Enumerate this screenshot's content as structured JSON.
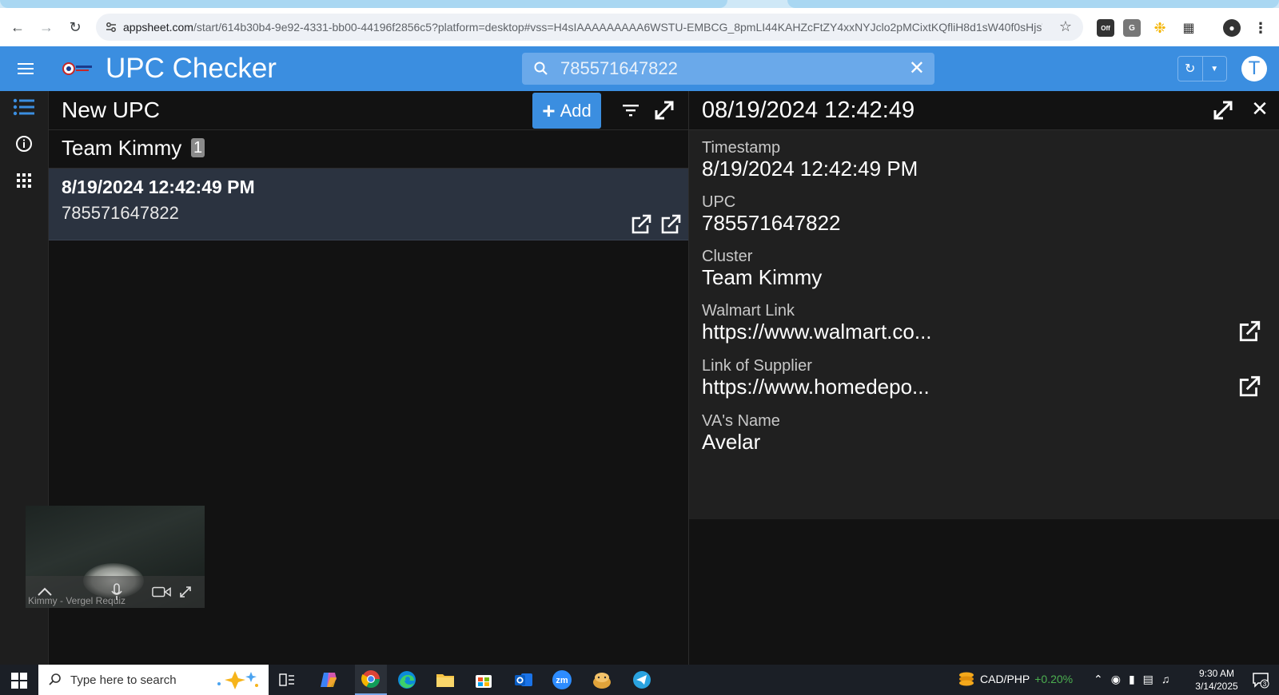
{
  "browser": {
    "url_host": "appsheet.com",
    "url_rest": "/start/614b30b4-9e92-4331-bb00-44196f2856c5?platform=desktop#vss=H4sIAAAAAAAAA6WSTU-EMBCG_8pmLI44KAHZcFtZY4xxNYJclo2pMCixtKQfliH8d1sW40f0sHjsTJ9..."
  },
  "header": {
    "title": "UPC Checker",
    "search_value": "785571647822",
    "avatar_letter": "T"
  },
  "list": {
    "title": "New UPC",
    "add_label": "Add",
    "group": {
      "name": "Team Kimmy",
      "count": "1"
    },
    "rows": [
      {
        "timestamp": "8/19/2024 12:42:49 PM",
        "upc": "785571647822"
      }
    ]
  },
  "detail": {
    "title": "08/19/2024 12:42:49",
    "fields": [
      {
        "label": "Timestamp",
        "value": "8/19/2024 12:42:49 PM"
      },
      {
        "label": "UPC",
        "value": "785571647822"
      },
      {
        "label": "Cluster",
        "value": "Team Kimmy"
      },
      {
        "label": "Walmart Link",
        "value": "https://www.walmart.co..."
      },
      {
        "label": "Link of Supplier",
        "value": "https://www.homedepo..."
      },
      {
        "label": "VA's Name",
        "value": "Avelar"
      }
    ]
  },
  "video": {
    "participant": "Kimmy - Vergel Requiz"
  },
  "taskbar": {
    "search_placeholder": "Type here to search",
    "fx_label": "CAD/PHP",
    "fx_change": "+0.20%",
    "time": "9:30 AM",
    "date": "3/14/2025",
    "notifications": "3"
  },
  "colors": {
    "accent": "#3b8ee0",
    "selected_row": "#2b3340",
    "panel": "#202020",
    "background": "#121212"
  }
}
